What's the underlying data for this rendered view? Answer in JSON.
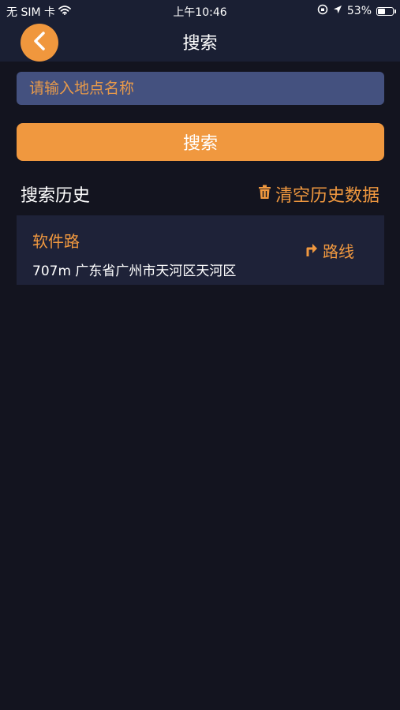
{
  "status_bar": {
    "carrier": "无 SIM 卡",
    "time": "上午10:46",
    "battery": "53%",
    "battery_level": 0.53
  },
  "header": {
    "title": "搜索"
  },
  "search": {
    "placeholder": "请输入地点名称",
    "button_label": "搜索"
  },
  "history": {
    "title": "搜索历史",
    "clear_label": "清空历史数据",
    "items": [
      {
        "name": "软件路",
        "address": "707m 广东省广州市天河区天河区",
        "route_label": "路线"
      }
    ]
  },
  "colors": {
    "accent": "#f0983f",
    "background": "#13141f",
    "bar": "#1a1f33",
    "input": "#44517f",
    "card": "#1e2238"
  }
}
